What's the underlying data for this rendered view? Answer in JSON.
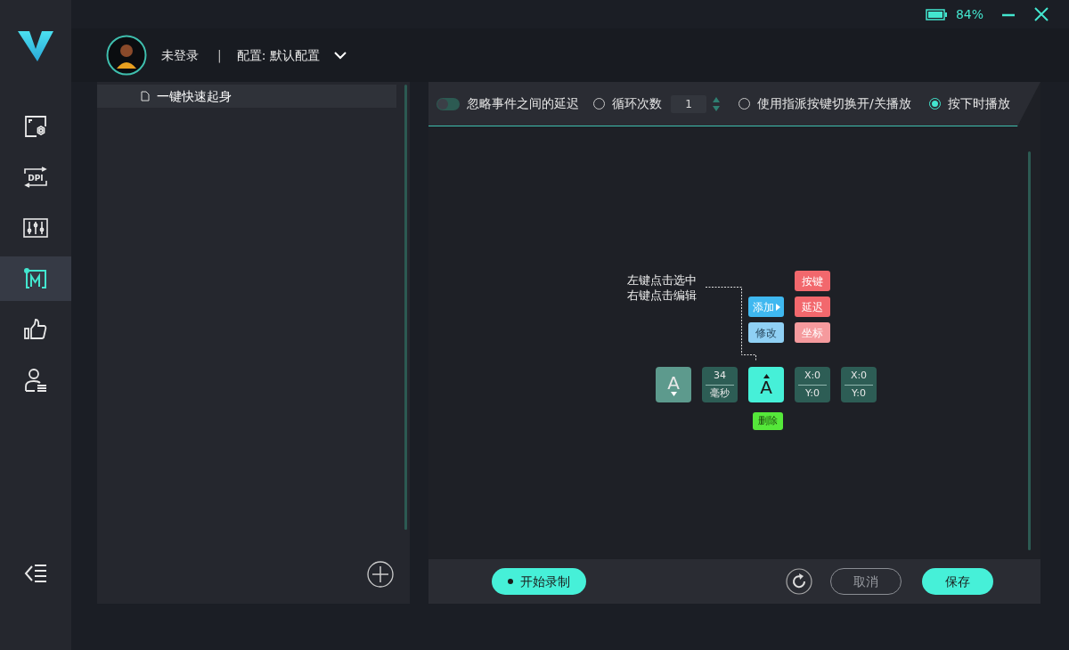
{
  "window": {
    "battery_text": "84%"
  },
  "sidebar": {
    "items": [
      {
        "kind": "display",
        "selected": false
      },
      {
        "kind": "dpi",
        "label": "DPI",
        "selected": false
      },
      {
        "kind": "mixer",
        "selected": false
      },
      {
        "kind": "macro",
        "selected": true
      },
      {
        "kind": "thumb",
        "selected": false
      },
      {
        "kind": "user",
        "selected": false
      }
    ]
  },
  "header": {
    "status": "未登录",
    "separator": "|",
    "config": "配置: 默认配置"
  },
  "macro_list": {
    "items": [
      {
        "name": "一键快速起身",
        "selected": true
      }
    ]
  },
  "toolbar": {
    "ignore_delay": {
      "label": "忽略事件之间的延迟",
      "on": false
    },
    "modes": [
      {
        "label": "循环次数",
        "selected": false,
        "count": "1"
      },
      {
        "label": "使用指派按键切换开/关播放",
        "selected": false
      },
      {
        "label": "按下时播放",
        "selected": true
      }
    ]
  },
  "hint": [
    "左键点击选中",
    "右键点击编辑"
  ],
  "context_menu": {
    "items": [
      {
        "label": "添加",
        "submenu": true,
        "color": "#3fb8f0"
      },
      {
        "label": "修改",
        "submenu": false,
        "color": "#8fd0f4"
      }
    ],
    "submenu": [
      {
        "label": "按键",
        "color": "#f2686d"
      },
      {
        "label": "延迟",
        "color": "#f2686d"
      },
      {
        "label": "坐标",
        "color": "#f59a9d"
      }
    ]
  },
  "events": [
    {
      "kind": "key",
      "label": "A",
      "released": false,
      "selected": false
    },
    {
      "kind": "delay",
      "value": "34",
      "unit": "毫秒",
      "selected": false
    },
    {
      "kind": "key",
      "label": "A",
      "released": true,
      "selected": true
    },
    {
      "kind": "coord",
      "x": "X:0",
      "y": "Y:0",
      "selected": false
    },
    {
      "kind": "coord",
      "x": "X:0",
      "y": "Y:0",
      "selected": false
    }
  ],
  "delete_button": "删除",
  "footer": {
    "record": "开始录制",
    "cancel": "取消",
    "save": "保存"
  }
}
